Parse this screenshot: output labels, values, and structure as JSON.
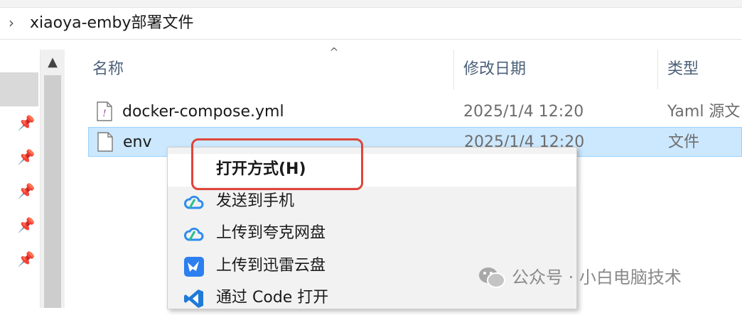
{
  "address_bar": {
    "path": "xiaoya-emby部署文件"
  },
  "columns": {
    "name": "名称",
    "modified": "修改日期",
    "type": "类型"
  },
  "files": [
    {
      "name": "docker-compose.yml",
      "modified": "2025/1/4 12:20",
      "type": "Yaml 源文",
      "icon": "yaml-file-icon"
    },
    {
      "name": "env",
      "modified": "2025/1/4 12:20",
      "type": "文件",
      "icon": "blank-file-icon",
      "selected": true
    }
  ],
  "context_menu": {
    "items": [
      {
        "label": "打开方式(H)",
        "icon": ""
      },
      {
        "label": "发送到手机",
        "icon": "cloud-icon"
      },
      {
        "label": "上传到夸克网盘",
        "icon": "cloud-icon"
      },
      {
        "label": "上传到迅雷云盘",
        "icon": "thunder-bird-icon"
      },
      {
        "label": "通过 Code 打开",
        "icon": "vscode-icon"
      }
    ]
  },
  "watermark": {
    "text": "公众号 · 小白电脑技术"
  },
  "colors": {
    "selection": "#cce8ff",
    "highlight": "#e0443a",
    "header_text": "#4c607a"
  }
}
